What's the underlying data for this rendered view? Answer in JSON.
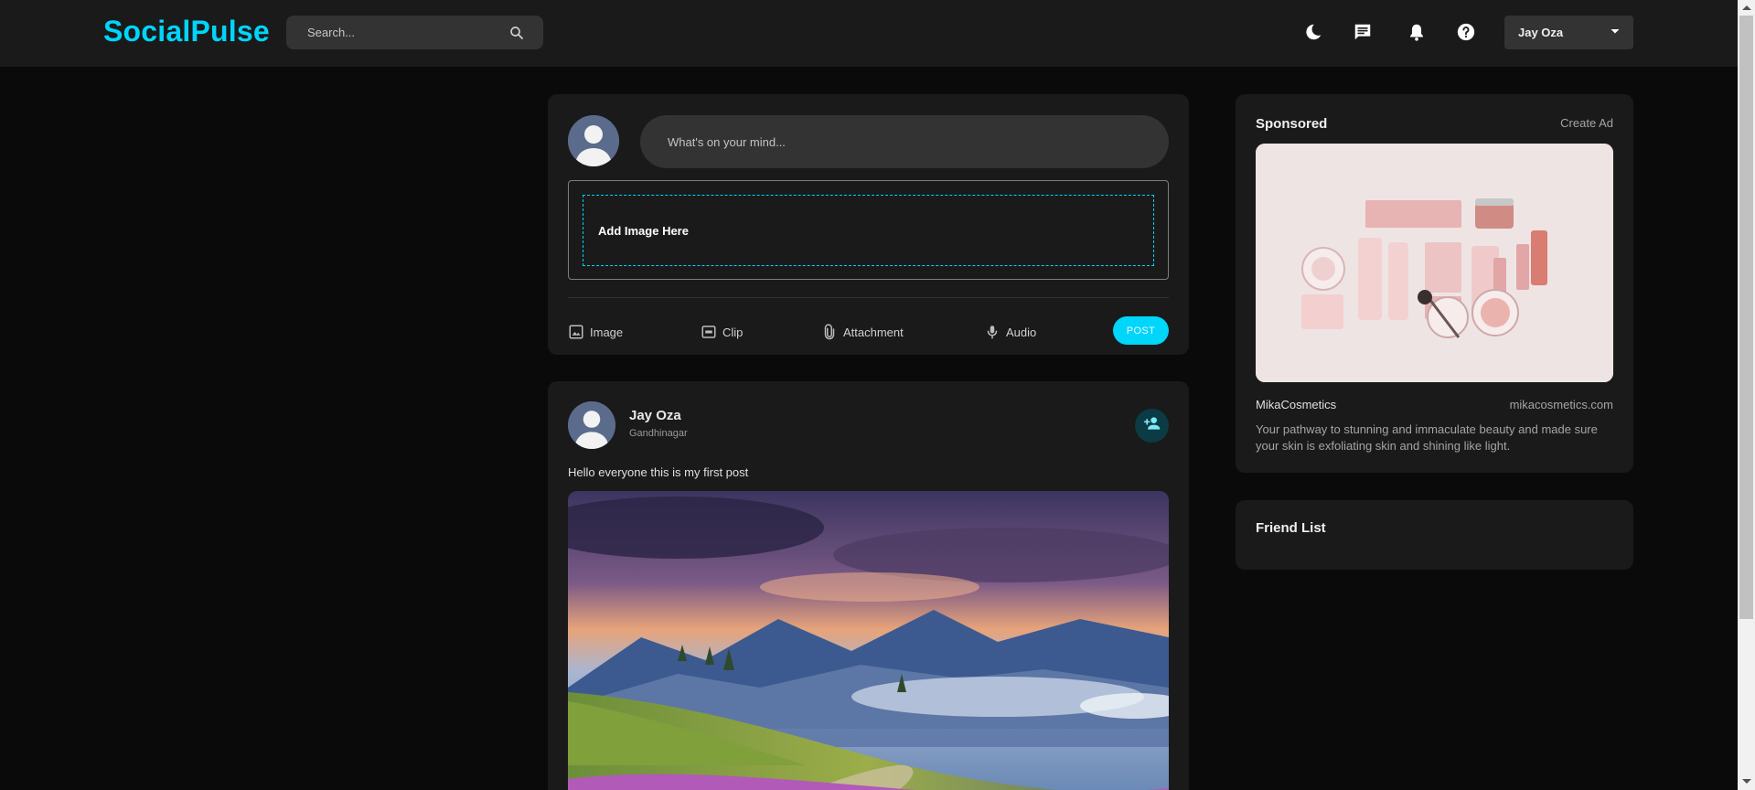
{
  "brand": {
    "name": "SocialPulse",
    "color": "#00d5fa"
  },
  "search": {
    "placeholder": "Search..."
  },
  "nav_icons": [
    "dark-mode-icon",
    "message-icon",
    "notification-icon",
    "help-icon"
  ],
  "user_menu": {
    "name": "Jay Oza"
  },
  "composer": {
    "placeholder": "What's on your mind...",
    "dropzone_label": "Add Image Here",
    "actions": [
      {
        "label": "Image",
        "icon": "image-icon"
      },
      {
        "label": "Clip",
        "icon": "gif-icon"
      },
      {
        "label": "Attachment",
        "icon": "attachment-icon"
      },
      {
        "label": "Audio",
        "icon": "microphone-icon"
      }
    ],
    "post_button": "POST"
  },
  "post": {
    "author": "Jay Oza",
    "location": "Gandhinagar",
    "text": "Hello everyone this is my first post"
  },
  "sponsored": {
    "title": "Sponsored",
    "create_ad": "Create Ad",
    "brand": "MikaCosmetics",
    "url": "mikacosmetics.com",
    "description": "Your pathway to stunning and immaculate beauty and made sure your skin is exfoliating skin and shining like light."
  },
  "friends": {
    "title": "Friend List"
  }
}
